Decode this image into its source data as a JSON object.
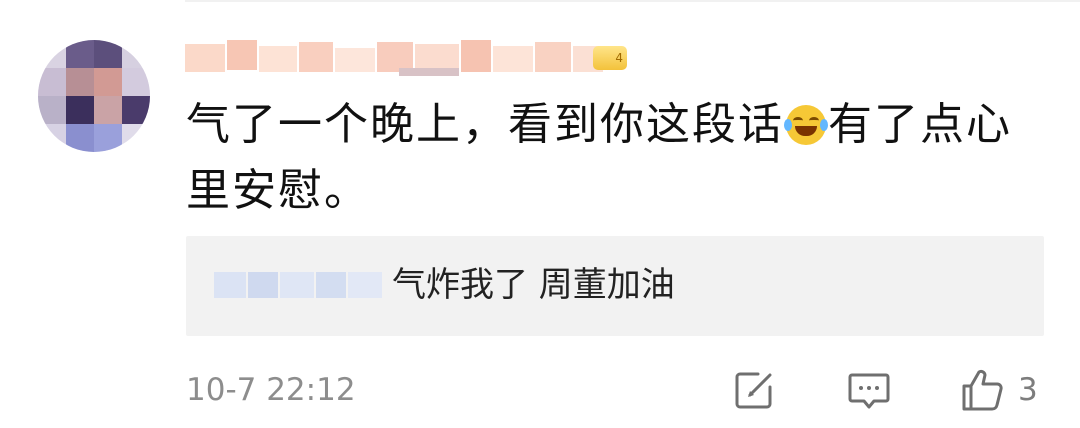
{
  "comment": {
    "text": "气了一个晚上，看到你这段话",
    "emoji": "laughing-tears-emoji",
    "text_after_emoji": "有了点心里安慰。"
  },
  "reply": {
    "text": "气炸我了 周董加油"
  },
  "meta": {
    "timestamp": "10-7 22:12",
    "like_count": "3"
  },
  "colors": {
    "text_primary": "#111111",
    "text_secondary": "#8d8d8d",
    "reply_background": "#f2f2f2",
    "badge_gold": "#f3c23b",
    "icon_gray": "#6f6f6f"
  },
  "icons": [
    "edit-icon",
    "comment-icon",
    "like-icon"
  ]
}
